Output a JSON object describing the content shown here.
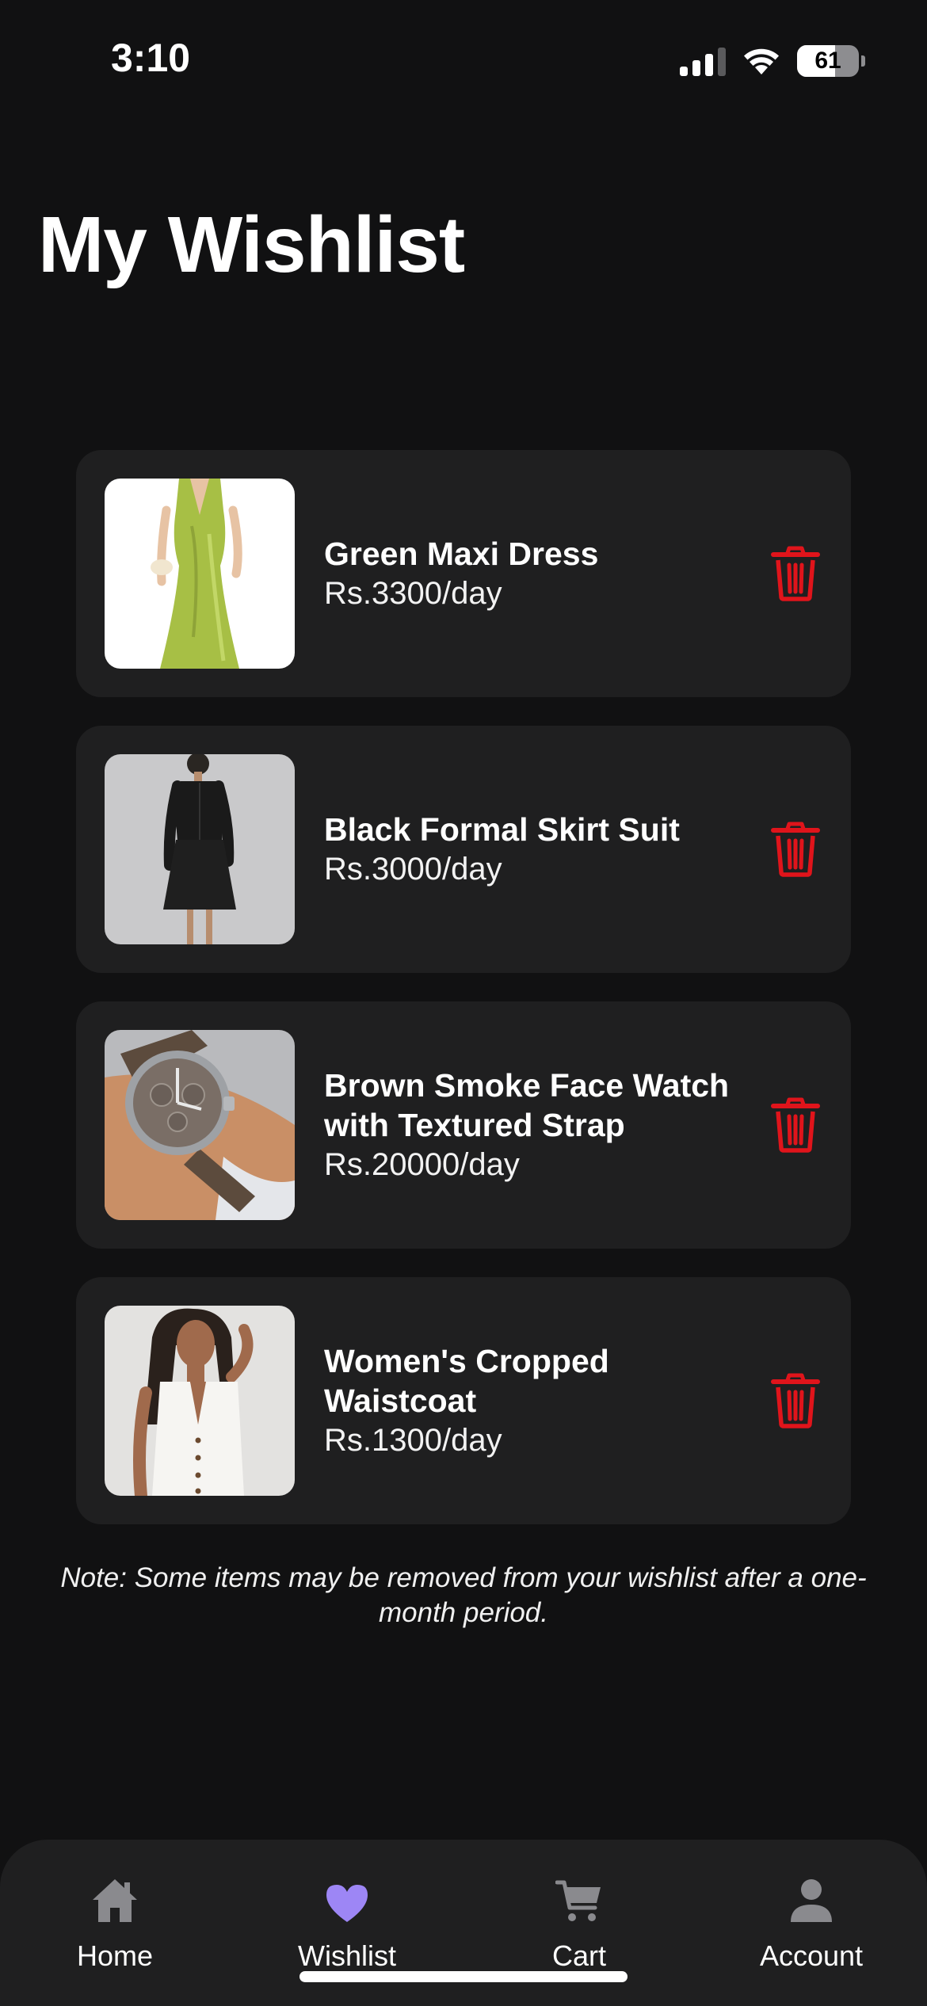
{
  "status_bar": {
    "time": "3:10",
    "battery_percent": "61",
    "battery_level": 0.61,
    "signal_bars_active": 3,
    "signal_bars_total": 4
  },
  "page": {
    "title": "My Wishlist"
  },
  "wishlist": {
    "items": [
      {
        "name": "Green Maxi Dress",
        "price": "Rs.3300/day",
        "image": "green-maxi-dress-image"
      },
      {
        "name": "Black Formal Skirt Suit",
        "price": "Rs.3000/day",
        "image": "black-formal-skirt-suit-image"
      },
      {
        "name": "Brown Smoke Face Watch with Textured Strap",
        "price": "Rs.20000/day",
        "image": "brown-smoke-face-watch-image"
      },
      {
        "name": "Women's Cropped Waistcoat",
        "price": "Rs.1300/day",
        "image": "womens-cropped-waistcoat-image"
      }
    ],
    "remove_icon": "trash-icon",
    "note": "Note: Some items may be removed from your wishlist after a one-month period."
  },
  "bottom_nav": {
    "active": "Wishlist",
    "items": [
      {
        "label": "Home",
        "icon": "home-icon"
      },
      {
        "label": "Wishlist",
        "icon": "heart-icon"
      },
      {
        "label": "Cart",
        "icon": "cart-icon"
      },
      {
        "label": "Account",
        "icon": "person-icon"
      }
    ]
  },
  "colors": {
    "background": "#111112",
    "card": "#1f1f20",
    "delete_red": "#e0141b",
    "active_accent": "#9d86f5",
    "inactive_icon": "#8a8a8e"
  }
}
